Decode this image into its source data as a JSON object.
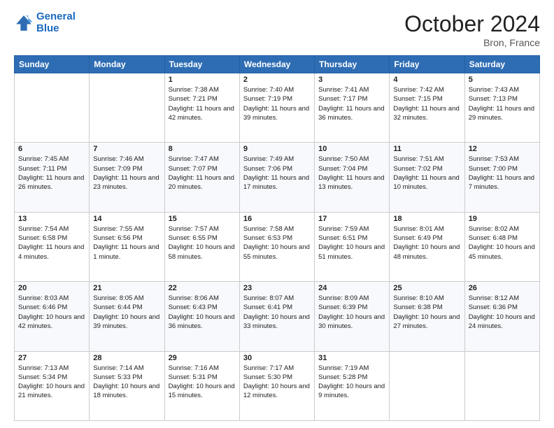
{
  "header": {
    "logo_line1": "General",
    "logo_line2": "Blue",
    "month": "October 2024",
    "location": "Bron, France"
  },
  "weekdays": [
    "Sunday",
    "Monday",
    "Tuesday",
    "Wednesday",
    "Thursday",
    "Friday",
    "Saturday"
  ],
  "weeks": [
    [
      {
        "day": "",
        "info": ""
      },
      {
        "day": "",
        "info": ""
      },
      {
        "day": "1",
        "info": "Sunrise: 7:38 AM\nSunset: 7:21 PM\nDaylight: 11 hours and 42 minutes."
      },
      {
        "day": "2",
        "info": "Sunrise: 7:40 AM\nSunset: 7:19 PM\nDaylight: 11 hours and 39 minutes."
      },
      {
        "day": "3",
        "info": "Sunrise: 7:41 AM\nSunset: 7:17 PM\nDaylight: 11 hours and 36 minutes."
      },
      {
        "day": "4",
        "info": "Sunrise: 7:42 AM\nSunset: 7:15 PM\nDaylight: 11 hours and 32 minutes."
      },
      {
        "day": "5",
        "info": "Sunrise: 7:43 AM\nSunset: 7:13 PM\nDaylight: 11 hours and 29 minutes."
      }
    ],
    [
      {
        "day": "6",
        "info": "Sunrise: 7:45 AM\nSunset: 7:11 PM\nDaylight: 11 hours and 26 minutes."
      },
      {
        "day": "7",
        "info": "Sunrise: 7:46 AM\nSunset: 7:09 PM\nDaylight: 11 hours and 23 minutes."
      },
      {
        "day": "8",
        "info": "Sunrise: 7:47 AM\nSunset: 7:07 PM\nDaylight: 11 hours and 20 minutes."
      },
      {
        "day": "9",
        "info": "Sunrise: 7:49 AM\nSunset: 7:06 PM\nDaylight: 11 hours and 17 minutes."
      },
      {
        "day": "10",
        "info": "Sunrise: 7:50 AM\nSunset: 7:04 PM\nDaylight: 11 hours and 13 minutes."
      },
      {
        "day": "11",
        "info": "Sunrise: 7:51 AM\nSunset: 7:02 PM\nDaylight: 11 hours and 10 minutes."
      },
      {
        "day": "12",
        "info": "Sunrise: 7:53 AM\nSunset: 7:00 PM\nDaylight: 11 hours and 7 minutes."
      }
    ],
    [
      {
        "day": "13",
        "info": "Sunrise: 7:54 AM\nSunset: 6:58 PM\nDaylight: 11 hours and 4 minutes."
      },
      {
        "day": "14",
        "info": "Sunrise: 7:55 AM\nSunset: 6:56 PM\nDaylight: 11 hours and 1 minute."
      },
      {
        "day": "15",
        "info": "Sunrise: 7:57 AM\nSunset: 6:55 PM\nDaylight: 10 hours and 58 minutes."
      },
      {
        "day": "16",
        "info": "Sunrise: 7:58 AM\nSunset: 6:53 PM\nDaylight: 10 hours and 55 minutes."
      },
      {
        "day": "17",
        "info": "Sunrise: 7:59 AM\nSunset: 6:51 PM\nDaylight: 10 hours and 51 minutes."
      },
      {
        "day": "18",
        "info": "Sunrise: 8:01 AM\nSunset: 6:49 PM\nDaylight: 10 hours and 48 minutes."
      },
      {
        "day": "19",
        "info": "Sunrise: 8:02 AM\nSunset: 6:48 PM\nDaylight: 10 hours and 45 minutes."
      }
    ],
    [
      {
        "day": "20",
        "info": "Sunrise: 8:03 AM\nSunset: 6:46 PM\nDaylight: 10 hours and 42 minutes."
      },
      {
        "day": "21",
        "info": "Sunrise: 8:05 AM\nSunset: 6:44 PM\nDaylight: 10 hours and 39 minutes."
      },
      {
        "day": "22",
        "info": "Sunrise: 8:06 AM\nSunset: 6:43 PM\nDaylight: 10 hours and 36 minutes."
      },
      {
        "day": "23",
        "info": "Sunrise: 8:07 AM\nSunset: 6:41 PM\nDaylight: 10 hours and 33 minutes."
      },
      {
        "day": "24",
        "info": "Sunrise: 8:09 AM\nSunset: 6:39 PM\nDaylight: 10 hours and 30 minutes."
      },
      {
        "day": "25",
        "info": "Sunrise: 8:10 AM\nSunset: 6:38 PM\nDaylight: 10 hours and 27 minutes."
      },
      {
        "day": "26",
        "info": "Sunrise: 8:12 AM\nSunset: 6:36 PM\nDaylight: 10 hours and 24 minutes."
      }
    ],
    [
      {
        "day": "27",
        "info": "Sunrise: 7:13 AM\nSunset: 5:34 PM\nDaylight: 10 hours and 21 minutes."
      },
      {
        "day": "28",
        "info": "Sunrise: 7:14 AM\nSunset: 5:33 PM\nDaylight: 10 hours and 18 minutes."
      },
      {
        "day": "29",
        "info": "Sunrise: 7:16 AM\nSunset: 5:31 PM\nDaylight: 10 hours and 15 minutes."
      },
      {
        "day": "30",
        "info": "Sunrise: 7:17 AM\nSunset: 5:30 PM\nDaylight: 10 hours and 12 minutes."
      },
      {
        "day": "31",
        "info": "Sunrise: 7:19 AM\nSunset: 5:28 PM\nDaylight: 10 hours and 9 minutes."
      },
      {
        "day": "",
        "info": ""
      },
      {
        "day": "",
        "info": ""
      }
    ]
  ]
}
